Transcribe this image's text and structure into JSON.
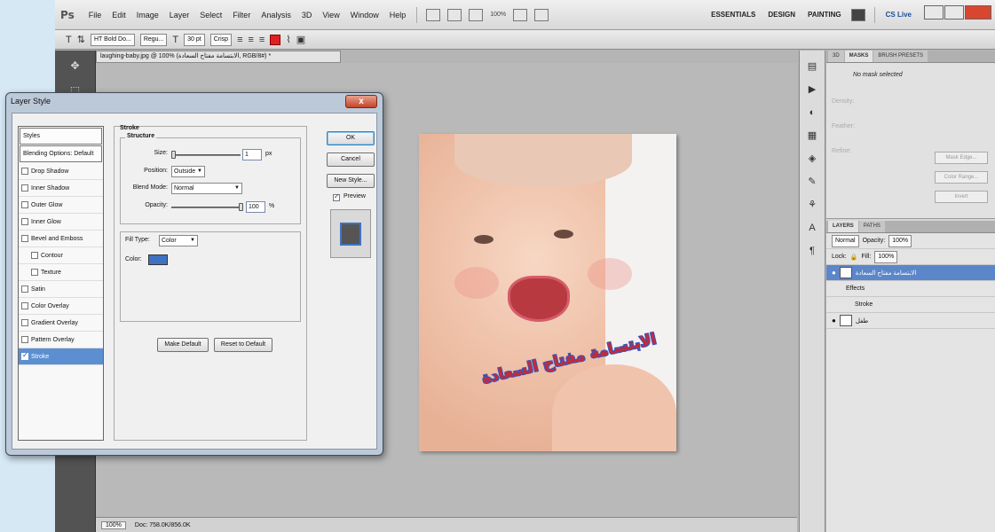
{
  "app": {
    "logo": "Ps",
    "menu": [
      "File",
      "Edit",
      "Image",
      "Layer",
      "Select",
      "Filter",
      "Analysis",
      "3D",
      "View",
      "Window",
      "Help"
    ],
    "zoom_select": "100%",
    "workspaces": [
      "ESSENTIALS",
      "DESIGN",
      "PAINTING"
    ],
    "cslive": "CS Live"
  },
  "options_bar": {
    "font_family": "HT Bold Do...",
    "font_style": "Regu...",
    "font_size": "30 pt",
    "anti_alias": "Crisp"
  },
  "document": {
    "tab_title": "laughing-baby.jpg @ 100% (الابتسامة مفتاح السعادة, RGB/8#) *",
    "arabic_text": "الابتسامة مفتاح السعادة",
    "status_zoom": "100%",
    "status_doc": "Doc: 758.0K/856.0K"
  },
  "masks_panel": {
    "tabs": [
      "3D",
      "MASKS",
      "BRUSH PRESETS"
    ],
    "status": "No mask selected",
    "density_label": "Density:",
    "feather_label": "Feather:",
    "refine_label": "Refine:",
    "buttons": [
      "Mask Edge...",
      "Color Range...",
      "Invert"
    ]
  },
  "layers_panel": {
    "tabs": [
      "LAYERS",
      "PATHS"
    ],
    "blend_mode": "Normal",
    "opacity_label": "Opacity:",
    "opacity": "100%",
    "lock_label": "Lock:",
    "fill_label": "Fill:",
    "fill": "100%",
    "layers": [
      {
        "name": "الابتسامة مفتاح السعادة",
        "selected": true
      },
      {
        "name": "Effects",
        "selected": false
      },
      {
        "name": "Stroke",
        "selected": false
      },
      {
        "name": "طفل",
        "selected": false
      }
    ]
  },
  "dialog": {
    "title": "Layer Style",
    "close": "x",
    "styles": [
      {
        "label": "Styles",
        "checkbox": false,
        "checked": false,
        "header": true,
        "indent": false,
        "active": false
      },
      {
        "label": "Blending Options: Default",
        "checkbox": false,
        "checked": false,
        "header": true,
        "indent": false,
        "active": false
      },
      {
        "label": "Drop Shadow",
        "checkbox": true,
        "checked": false,
        "header": false,
        "indent": false,
        "active": false
      },
      {
        "label": "Inner Shadow",
        "checkbox": true,
        "checked": false,
        "header": false,
        "indent": false,
        "active": false
      },
      {
        "label": "Outer Glow",
        "checkbox": true,
        "checked": false,
        "header": false,
        "indent": false,
        "active": false
      },
      {
        "label": "Inner Glow",
        "checkbox": true,
        "checked": false,
        "header": false,
        "indent": false,
        "active": false
      },
      {
        "label": "Bevel and Emboss",
        "checkbox": true,
        "checked": false,
        "header": false,
        "indent": false,
        "active": false
      },
      {
        "label": "Contour",
        "checkbox": true,
        "checked": false,
        "header": false,
        "indent": true,
        "active": false
      },
      {
        "label": "Texture",
        "checkbox": true,
        "checked": false,
        "header": false,
        "indent": true,
        "active": false
      },
      {
        "label": "Satin",
        "checkbox": true,
        "checked": false,
        "header": false,
        "indent": false,
        "active": false
      },
      {
        "label": "Color Overlay",
        "checkbox": true,
        "checked": false,
        "header": false,
        "indent": false,
        "active": false
      },
      {
        "label": "Gradient Overlay",
        "checkbox": true,
        "checked": false,
        "header": false,
        "indent": false,
        "active": false
      },
      {
        "label": "Pattern Overlay",
        "checkbox": true,
        "checked": false,
        "header": false,
        "indent": false,
        "active": false
      },
      {
        "label": "Stroke",
        "checkbox": true,
        "checked": true,
        "header": false,
        "indent": false,
        "active": true
      }
    ],
    "stroke": {
      "title": "Stroke",
      "structure_title": "Structure",
      "size_label": "Size:",
      "size_value": "1",
      "size_unit": "px",
      "position_label": "Position:",
      "position_value": "Outside",
      "blend_label": "Blend Mode:",
      "blend_value": "Normal",
      "opacity_label": "Opacity:",
      "opacity_value": "100",
      "opacity_unit": "%",
      "fill_type_label": "Fill Type:",
      "fill_type_value": "Color",
      "color_label": "Color:",
      "stroke_color": "#3f73c2",
      "make_default": "Make Default",
      "reset_default": "Reset to Default"
    },
    "buttons": {
      "ok": "OK",
      "cancel": "Cancel",
      "new_style": "New Style...",
      "preview_label": "Preview",
      "preview_checked": true
    }
  }
}
